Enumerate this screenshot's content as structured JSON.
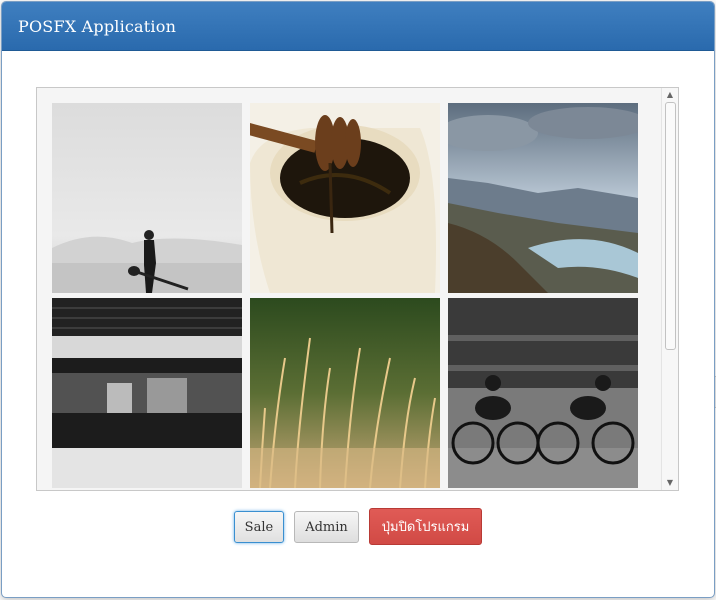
{
  "window": {
    "title": "POSFX Application"
  },
  "gallery": {
    "images": [
      {
        "name": "desert-guitarist-photo"
      },
      {
        "name": "honey-dipper-photo"
      },
      {
        "name": "mountain-lake-photo"
      },
      {
        "name": "subway-train-photo"
      },
      {
        "name": "wild-grass-photo"
      },
      {
        "name": "cyclists-motion-photo"
      }
    ]
  },
  "buttons": {
    "sale_label": "Sale",
    "admin_label": "Admin",
    "exit_label": "ปุ่มปิดโปรแกรม"
  },
  "colors": {
    "header": "#2f6fb0",
    "danger": "#d9534f",
    "focus": "#66afe9"
  }
}
